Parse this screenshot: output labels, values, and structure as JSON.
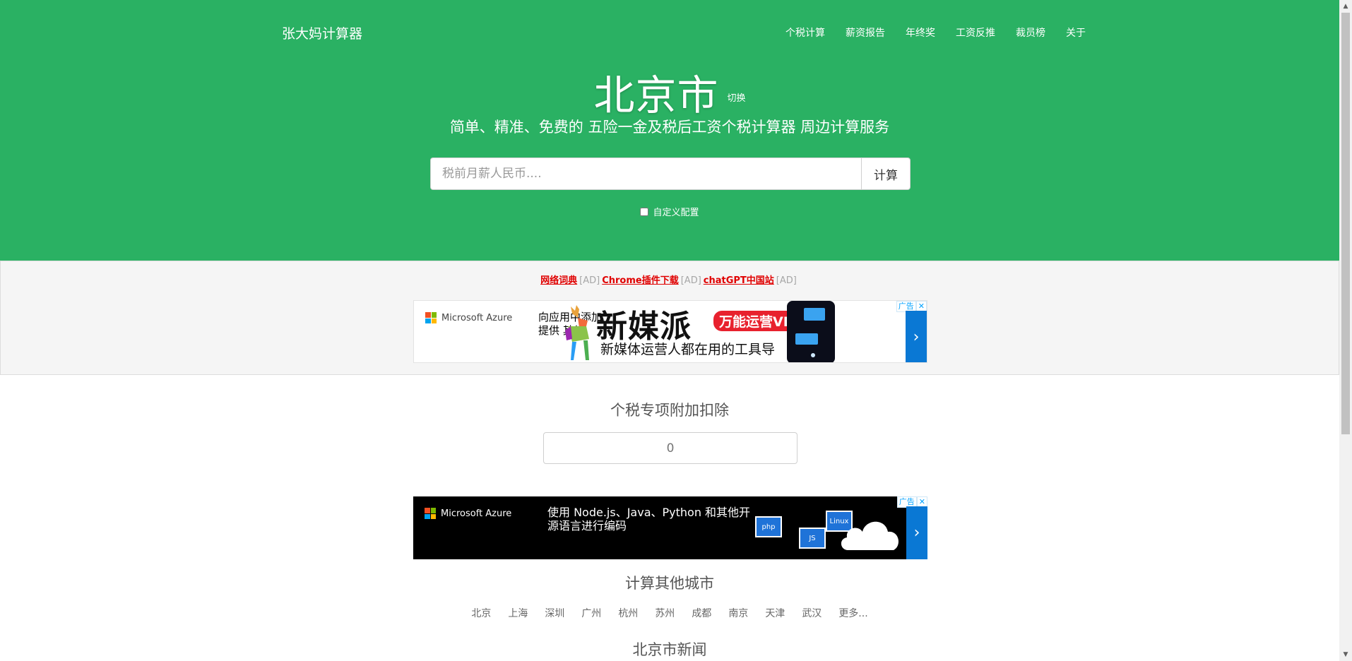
{
  "header": {
    "brand": "张大妈计算器",
    "nav": [
      "个税计算",
      "薪资报告",
      "年终奖",
      "工资反推",
      "裁员榜",
      "关于"
    ]
  },
  "hero": {
    "city": "北京市",
    "switch_label": "切换",
    "subtitle": "简单、精准、免费的 五险一金及税后工资个税计算器 周边计算服务",
    "search_placeholder": "税前月薪人民币....",
    "calc_button": "计算",
    "custom_config_label": "自定义配置"
  },
  "ad_links": [
    {
      "label": "网络词典",
      "tag": "[AD]"
    },
    {
      "label": "Chrome插件下载",
      "tag": "[AD]"
    },
    {
      "label": "chatGPT中国站",
      "tag": "[AD]"
    }
  ],
  "ads": {
    "ad_mark": "广告",
    "close_mark": "✕",
    "arrow": "›",
    "sponsor": "Microsoft Azure",
    "banner1": {
      "body_line1": "向应用中添加",
      "body_line2": "提供 其他",
      "headline": "新媒派",
      "badge": "万能运营VIP",
      "tagline": "新媒体运营人都在用的工具导"
    },
    "banner2": {
      "body": "使用 Node.js、Java、Python 和其他开源语言进行编码",
      "tile_php": "php",
      "tile_linux": "Linux",
      "tile_js": "JS"
    }
  },
  "deduction": {
    "title": "个税专项附加扣除",
    "value": "0"
  },
  "other_cities": {
    "title": "计算其他城市",
    "items": [
      "北京",
      "上海",
      "深圳",
      "广州",
      "杭州",
      "苏州",
      "成都",
      "南京",
      "天津",
      "武汉",
      "更多..."
    ]
  },
  "news": {
    "title": "北京市新闻"
  },
  "colors": {
    "hero_bg": "#2ab163",
    "ad_link": "#e00000",
    "azure_blue": "#0a78d4"
  },
  "scrollbar": {
    "up": "▲",
    "down": "▼"
  }
}
